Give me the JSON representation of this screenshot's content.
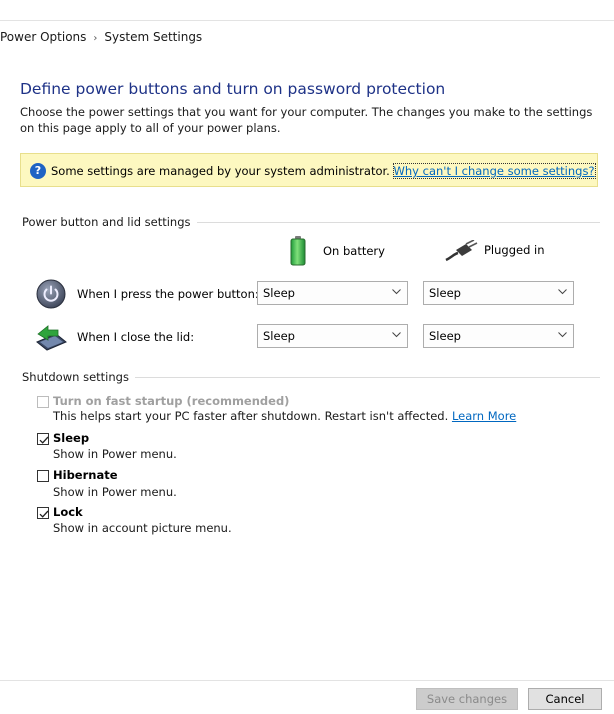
{
  "breadcrumb": {
    "items": [
      "Power Options",
      "System Settings"
    ],
    "separator": "›"
  },
  "page": {
    "title": "Define power buttons and turn on password protection",
    "description": "Choose the power settings that you want for your computer. The changes you make to the settings on this page apply to all of your power plans."
  },
  "info_bar": {
    "icon": "question-icon",
    "text": "Some settings are managed by your system administrator.",
    "link": "Why can't I change some settings?"
  },
  "power_section": {
    "label": "Power button and lid settings",
    "columns": {
      "battery": {
        "label": "On battery",
        "icon": "battery-icon"
      },
      "plugged": {
        "label": "Plugged in",
        "icon": "plug-icon"
      }
    },
    "rows": [
      {
        "icon": "power-button-icon",
        "label": "When I press the power button:",
        "battery": "Sleep",
        "plugged": "Sleep"
      },
      {
        "icon": "laptop-lid-icon",
        "label": "When I close the lid:",
        "battery": "Sleep",
        "plugged": "Sleep"
      }
    ]
  },
  "shutdown_section": {
    "label": "Shutdown settings",
    "options": [
      {
        "title": "Turn on fast startup (recommended)",
        "description": "This helps start your PC faster after shutdown. Restart isn't affected.",
        "link": "Learn More",
        "checked": false,
        "disabled": true
      },
      {
        "title": "Sleep",
        "description": "Show in Power menu.",
        "checked": true,
        "disabled": false
      },
      {
        "title": "Hibernate",
        "description": "Show in Power menu.",
        "checked": false,
        "disabled": false
      },
      {
        "title": "Lock",
        "description": "Show in account picture menu.",
        "checked": true,
        "disabled": false
      }
    ]
  },
  "footer": {
    "save_label": "Save changes",
    "save_enabled": false,
    "cancel_label": "Cancel"
  },
  "colors": {
    "title": "#1e3287",
    "link": "#0067c0",
    "info_background": "#fdf8c0",
    "info_icon": "#1e63c4"
  }
}
